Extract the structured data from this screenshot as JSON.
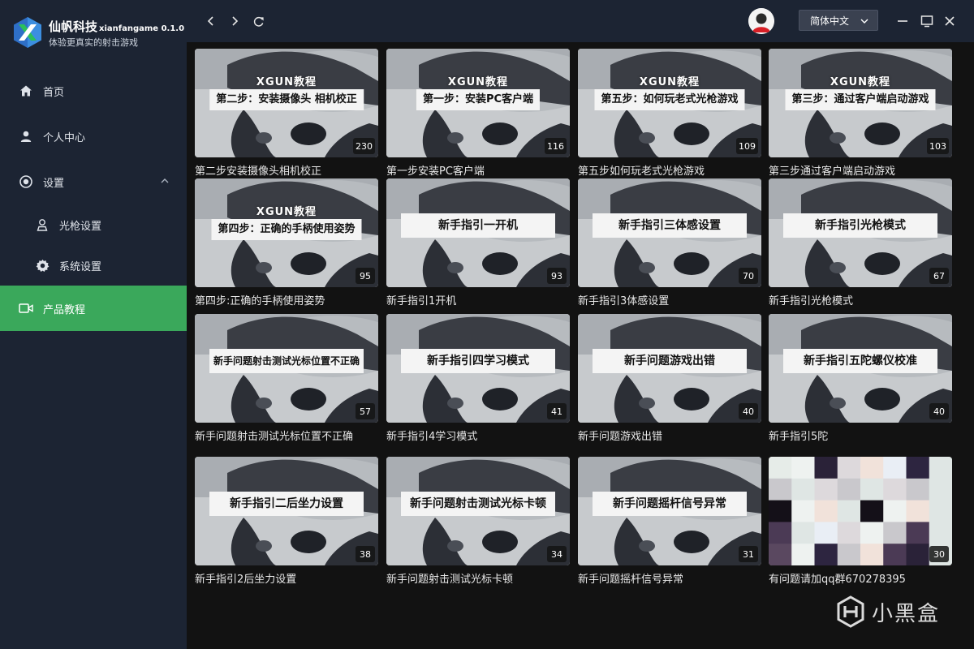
{
  "brand": {
    "name": "仙帆科技",
    "version": "xianfangame 0.1.0",
    "slogan": "体验更真实的射击游戏"
  },
  "menu": {
    "home": "首页",
    "profile": "个人中心",
    "settings": "设置",
    "gun_settings": "光枪设置",
    "system_settings": "系统设置",
    "tutorials": "产品教程"
  },
  "topbar": {
    "language": "简体中文"
  },
  "colors": {
    "accent": "#3aa85b",
    "sidebar": "#1c2433",
    "content_bg": "#121212"
  },
  "cards": [
    {
      "brand": "XGUN教程",
      "banner": "第二步：安装摄像头 相机校正",
      "count": "230",
      "title": "第二步安装摄像头相机校正"
    },
    {
      "brand": "XGUN教程",
      "banner": "第一步：安装PC客户端",
      "count": "116",
      "title": "第一步安装PC客户端"
    },
    {
      "brand": "XGUN教程",
      "banner": "第五步：如何玩老式光枪游戏",
      "count": "109",
      "title": "第五步如何玩老式光枪游戏"
    },
    {
      "brand": "XGUN教程",
      "banner": "第三步：通过客户端启动游戏",
      "count": "103",
      "title": "第三步通过客户端启动游戏"
    },
    {
      "brand": "XGUN教程",
      "banner": "第四步：正确的手柄使用姿势",
      "count": "95",
      "title": "第四步:正确的手柄使用姿势"
    },
    {
      "brand": "",
      "banner": "新手指引一开机",
      "count": "93",
      "title": "新手指引1开机"
    },
    {
      "brand": "",
      "banner": "新手指引三体感设置",
      "count": "70",
      "title": "新手指引3体感设置"
    },
    {
      "brand": "",
      "banner": "新手指引光枪模式",
      "count": "67",
      "title": "新手指引光枪模式"
    },
    {
      "brand": "",
      "banner": "新手问题射击测试光标位置不正确",
      "count": "57",
      "title": "新手问题射击测试光标位置不正确"
    },
    {
      "brand": "",
      "banner": "新手指引四学习模式",
      "count": "41",
      "title": "新手指引4学习模式"
    },
    {
      "brand": "",
      "banner": "新手问题游戏出错",
      "count": "40",
      "title": "新手问题游戏出错"
    },
    {
      "brand": "",
      "banner": "新手指引五陀螺仪校准",
      "count": "40",
      "title": "新手指引5陀"
    },
    {
      "brand": "",
      "banner": "新手指引二后坐力设置",
      "count": "38",
      "title": "新手指引2后坐力设置"
    },
    {
      "brand": "",
      "banner": "新手问题射击测试光标卡顿",
      "count": "34",
      "title": "新手问题射击测试光标卡顿"
    },
    {
      "brand": "",
      "banner": "新手问题摇杆信号异常",
      "count": "31",
      "title": "新手问题摇杆信号异常"
    },
    {
      "brand": "",
      "banner": "",
      "count": "30",
      "title": "有问题请加qq群670278395"
    }
  ],
  "watermark": {
    "text": "小黑盒"
  }
}
